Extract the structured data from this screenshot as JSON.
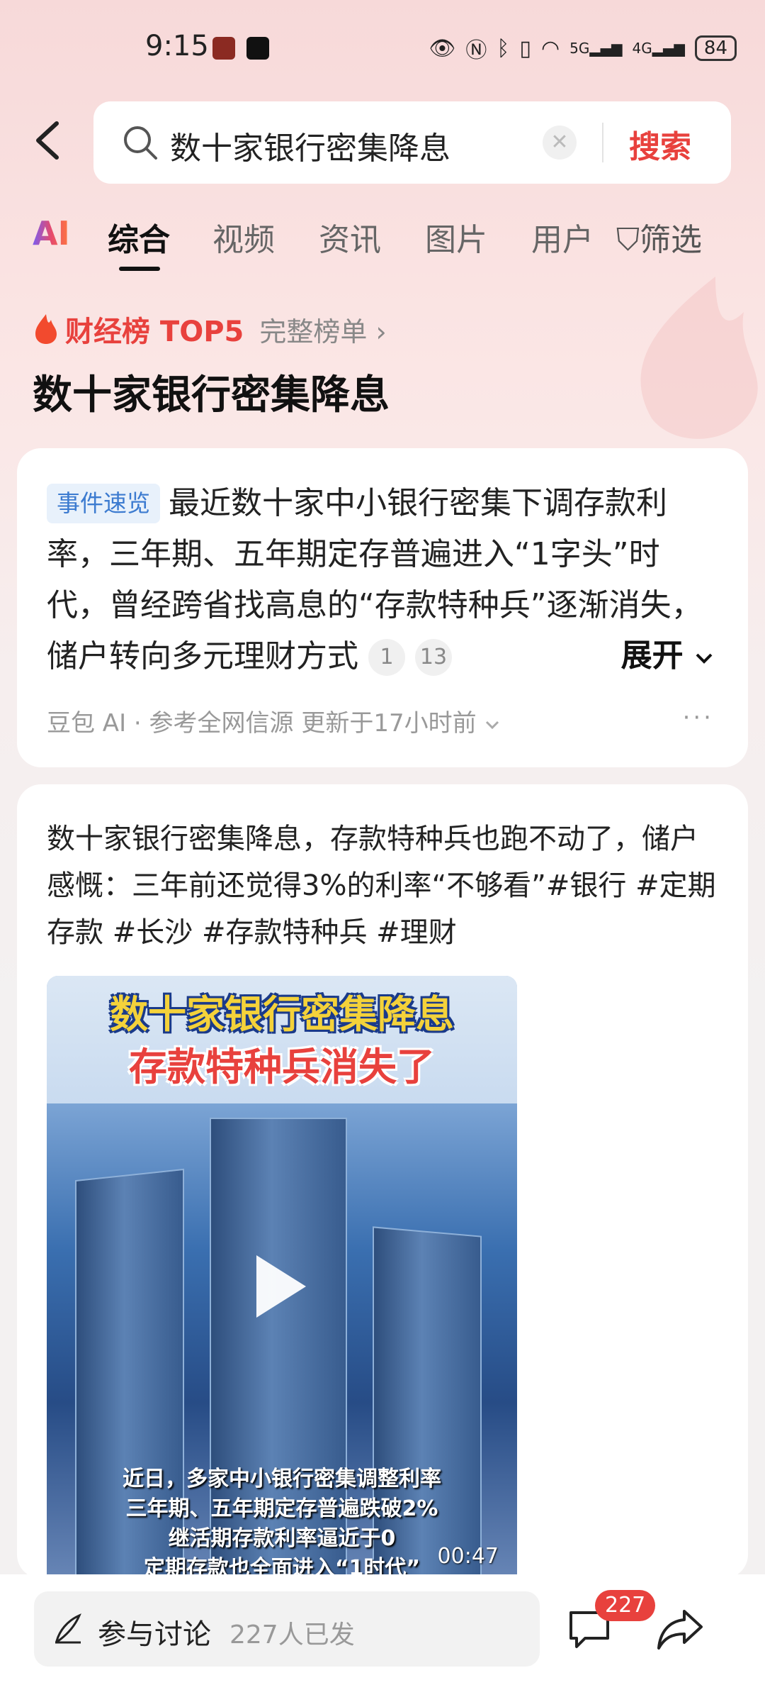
{
  "status_bar": {
    "time": "9:15",
    "battery": "84",
    "net_5g": "5G",
    "net_4g": "4G"
  },
  "search": {
    "query": "数十家银行密集降息",
    "submit_label": "搜索"
  },
  "tabs": [
    {
      "label": "AI"
    },
    {
      "label": "综合"
    },
    {
      "label": "视频"
    },
    {
      "label": "资讯"
    },
    {
      "label": "图片"
    },
    {
      "label": "用户"
    },
    {
      "label": "筛选"
    }
  ],
  "ranking": {
    "label": "财经榜 TOP5",
    "full_list": "完整榜单 ›"
  },
  "topic_title": "数十家银行密集降息",
  "ai_summary": {
    "tag": "事件速览",
    "text": "最近数十家中小银行密集下调存款利率，三年期、五年期定存普遍进入“1字头”时代，曾经跨省找高息的“存款特种兵”逐渐消失，储户转向多元理财方式",
    "cite_1": "1",
    "cite_2": "13",
    "expand": "展开",
    "source": "豆包 AI · 参考全网信源 更新于17小时前",
    "more": "···"
  },
  "post": {
    "text": "数十家银行密集降息，存款特种兵也跑不动了，储户感慨：三年前还觉得3%的利率“不够看”#银行 #定期存款 #长沙 #存款特种兵 #理财",
    "video_title_1": "数十家银行密集降息",
    "video_title_2": "存款特种兵消失了",
    "subtitles": [
      "近日，多家中小银行密集调整利率",
      "三年期、五年期定存普遍跌破2%",
      "继活期存款利率逼近于0",
      "定期存款也全面进入“1时代”"
    ],
    "duration": "00:47"
  },
  "bottom_bar": {
    "discuss_label": "参与讨论",
    "discuss_count": "227人已发",
    "comment_badge": "227"
  }
}
